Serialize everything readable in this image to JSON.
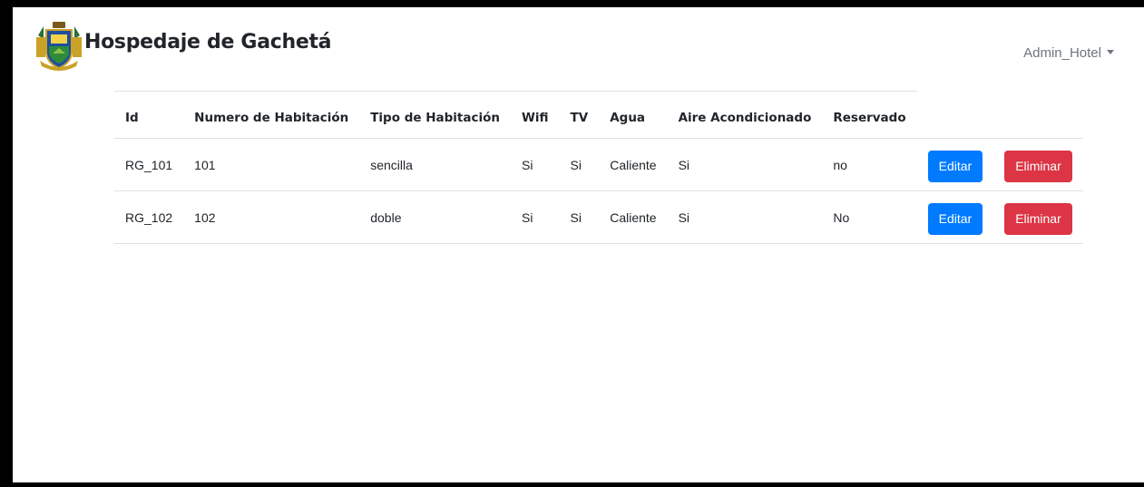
{
  "navbar": {
    "title": "Hospedaje de Gachetá",
    "logo_icon": "coat-of-arms-logo",
    "user": "Admin_Hotel"
  },
  "table": {
    "headers": [
      "Id",
      "Numero de Habitación",
      "Tipo de Habitación",
      "Wifi",
      "TV",
      "Agua",
      "Aire Acondicionado",
      "Reservado"
    ],
    "rows": [
      {
        "id": "RG_101",
        "numero": "101",
        "tipo": "sencilla",
        "wifi": "Si",
        "tv": "Si",
        "agua": "Caliente",
        "aire": "Si",
        "reservado": "no",
        "edit_label": "Editar",
        "delete_label": "Eliminar"
      },
      {
        "id": "RG_102",
        "numero": "102",
        "tipo": "doble",
        "wifi": "Si",
        "tv": "Si",
        "agua": "Caliente",
        "aire": "Si",
        "reservado": "No",
        "edit_label": "Editar",
        "delete_label": "Eliminar"
      }
    ]
  },
  "colors": {
    "edit_button": "#007bff",
    "delete_button": "#dc3545",
    "muted_text": "#6c757d"
  }
}
